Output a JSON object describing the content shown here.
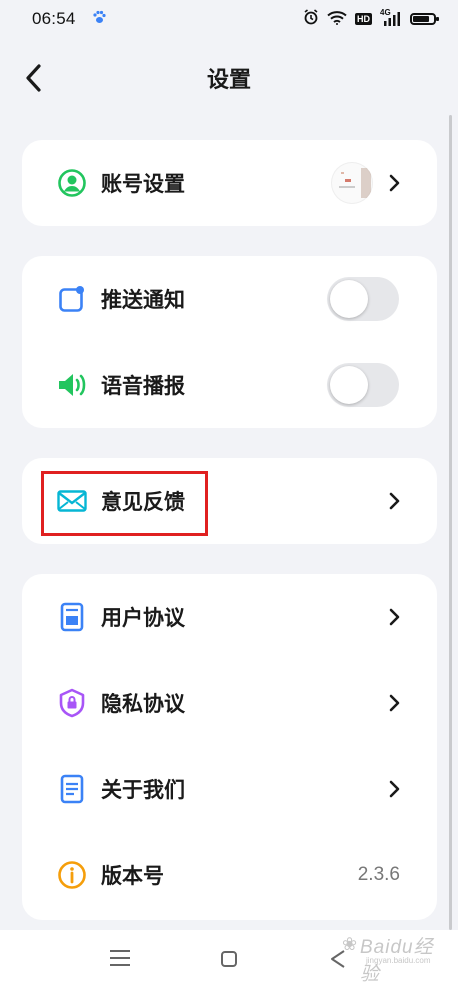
{
  "status_bar": {
    "time": "06:54",
    "network_type": "4G",
    "hd_label": "HD",
    "battery_level": 0.85
  },
  "header": {
    "title": "设置"
  },
  "sections": {
    "account": {
      "label": "账号设置"
    },
    "notifications": {
      "push_label": "推送通知",
      "push_enabled": false,
      "voice_label": "语音播报",
      "voice_enabled": false
    },
    "feedback": {
      "label": "意见反馈"
    },
    "about": {
      "user_agreement_label": "用户协议",
      "privacy_label": "隐私协议",
      "about_us_label": "关于我们",
      "version_label": "版本号",
      "version_value": "2.3.6"
    }
  },
  "colors": {
    "account_icon": "#22c55e",
    "push_icon": "#3b82f6",
    "voice_icon": "#22c55e",
    "feedback_icon": "#06b6d4",
    "user_agreement_icon": "#3b82f6",
    "privacy_icon": "#a855f7",
    "about_icon": "#3b82f6",
    "version_icon": "#f59e0b",
    "highlight": "#e02020"
  },
  "watermark": {
    "text": "Baidu经验",
    "sub": "jingyan.baidu.com"
  }
}
